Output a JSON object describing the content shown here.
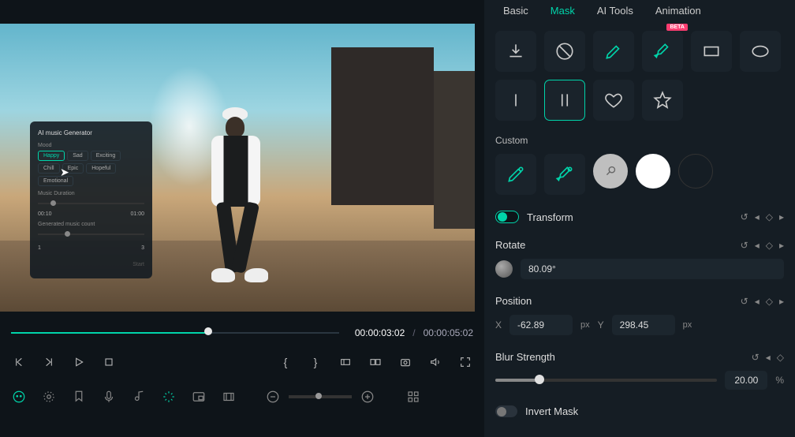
{
  "tabs": {
    "basic": "Basic",
    "mask": "Mask",
    "ai_tools": "AI Tools",
    "animation": "Animation"
  },
  "badge": "BETA",
  "custom_label": "Custom",
  "transform": {
    "label": "Transform"
  },
  "rotate": {
    "label": "Rotate",
    "value": "80.09°"
  },
  "position": {
    "label": "Position",
    "x_label": "X",
    "x_value": "-62.89",
    "x_unit": "px",
    "y_label": "Y",
    "y_value": "298.45",
    "y_unit": "px"
  },
  "blur": {
    "label": "Blur Strength",
    "value": "20.00",
    "unit": "%",
    "pct": 20
  },
  "invert": {
    "label": "Invert Mask"
  },
  "timecode": {
    "current": "00:00:03:02",
    "sep": "/",
    "duration": "00:00:05:02"
  },
  "progress_pct": 60,
  "ai_panel": {
    "title": "AI music Generator",
    "mood_label": "Mood",
    "moods": [
      "Happy",
      "Sad",
      "Exciting",
      "Chill",
      "Epic",
      "Hopeful",
      "Emotional"
    ],
    "sel_mood": 0,
    "duration_label": "Music Duration",
    "dur_from": "00:10",
    "dur_to": "01:00",
    "count_label": "Generated music count",
    "count_from": "1",
    "count_to": "3",
    "start_label": "Start"
  }
}
